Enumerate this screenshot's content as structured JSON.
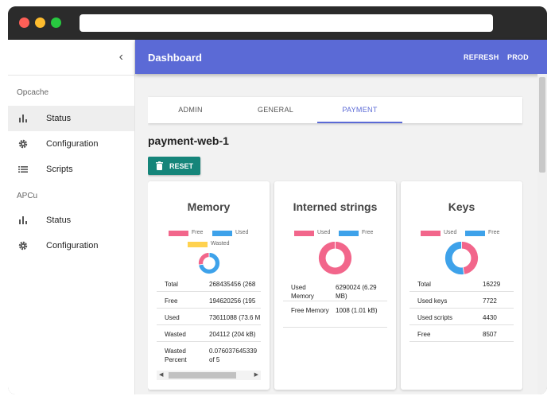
{
  "app": {
    "title": "Dashboard",
    "actions": {
      "refresh": "REFRESH",
      "prod": "PROD"
    }
  },
  "sidebar": {
    "sections": [
      {
        "label": "Opcache",
        "items": [
          {
            "label": "Status",
            "icon": "bar-chart-icon",
            "active": true
          },
          {
            "label": "Configuration",
            "icon": "gear-icon",
            "active": false
          },
          {
            "label": "Scripts",
            "icon": "list-icon",
            "active": false
          }
        ]
      },
      {
        "label": "APCu",
        "items": [
          {
            "label": "Status",
            "icon": "bar-chart-icon",
            "active": false
          },
          {
            "label": "Configuration",
            "icon": "gear-icon",
            "active": false
          }
        ]
      }
    ]
  },
  "tabs": [
    {
      "label": "ADMIN",
      "active": false
    },
    {
      "label": "GENERAL",
      "active": false
    },
    {
      "label": "PAYMENT",
      "active": true
    }
  ],
  "server": {
    "name": "payment-web-1",
    "reset_label": "RESET"
  },
  "colors": {
    "used": "#f2668b",
    "free": "#3ea2ea",
    "wasted": "#ffd24f",
    "primary": "#5b6ad6",
    "reset": "#15857a"
  },
  "cards": {
    "memory": {
      "title": "Memory",
      "legend": [
        "Free",
        "Used",
        "Wasted"
      ],
      "chart": {
        "used": 73611088,
        "free": 194620256,
        "wasted": 204112
      },
      "rows": [
        {
          "key": "Total",
          "value": "268435456 (268"
        },
        {
          "key": "Free",
          "value": "194620256 (195"
        },
        {
          "key": "Used",
          "value": "73611088 (73.6 M"
        },
        {
          "key": "Wasted",
          "value": "204112 (204 kB)"
        },
        {
          "key": "Wasted Percent",
          "value": "0.076037645339 of 5"
        }
      ]
    },
    "interned": {
      "title": "Interned strings",
      "legend": [
        "Used",
        "Free"
      ],
      "chart": {
        "used": 6290024,
        "free": 1008
      },
      "rows": [
        {
          "key": "Used Memory",
          "value": "6290024 (6.29 MB)"
        },
        {
          "key": "Free Memory",
          "value": "1008 (1.01 kB)"
        }
      ]
    },
    "keys": {
      "title": "Keys",
      "legend": [
        "Used",
        "Free"
      ],
      "chart": {
        "used": 7722,
        "free": 8507
      },
      "rows": [
        {
          "key": "Total",
          "value": "16229"
        },
        {
          "key": "Used keys",
          "value": "7722"
        },
        {
          "key": "Used scripts",
          "value": "4430"
        },
        {
          "key": "Free",
          "value": "8507"
        }
      ]
    }
  }
}
